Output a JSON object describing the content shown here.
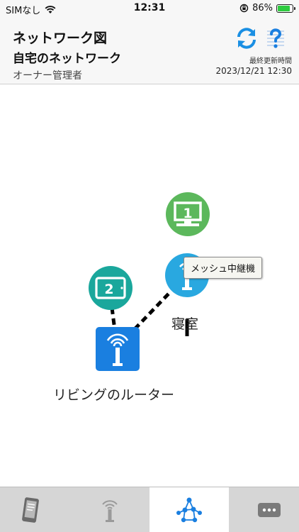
{
  "status_bar": {
    "carrier": "SIMなし",
    "time": "12:31",
    "battery_percent": "86%",
    "battery_level": 0.86
  },
  "header": {
    "title": "ネットワーク図",
    "network_name": "自宅のネットワーク",
    "role": "オーナー管理者",
    "last_updated_label": "最終更新時間",
    "last_updated_value": "2023/12/21 12:30"
  },
  "colors": {
    "accent_blue": "#1a8fe3",
    "device_green": "#5cb85c",
    "device_teal": "#1aa79c",
    "mesh_blue": "#29a8e0",
    "router_blue": "#1a7fe0"
  },
  "map": {
    "router_label": "リビングのルーター",
    "mesh_label": "寝室",
    "tooltip": "メッシュ中継機",
    "device_1_badge": "1",
    "device_2_badge": "2"
  },
  "tabs": [
    {
      "name": "device",
      "icon": "smartphone-icon",
      "active": false
    },
    {
      "name": "router",
      "icon": "router-icon",
      "active": false
    },
    {
      "name": "network-map",
      "icon": "network-icon",
      "active": true
    },
    {
      "name": "more",
      "icon": "more-icon",
      "active": false
    }
  ]
}
